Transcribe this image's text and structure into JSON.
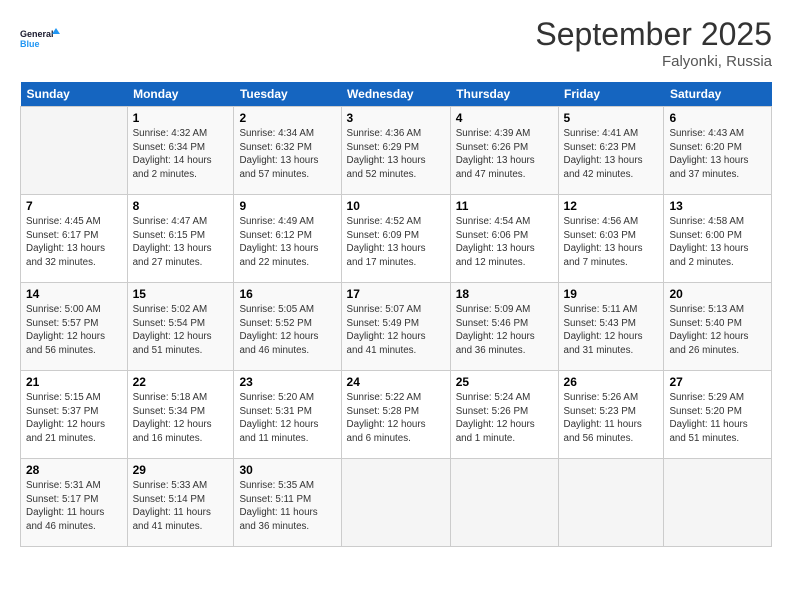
{
  "logo": {
    "line1": "General",
    "line2": "Blue"
  },
  "title": "September 2025",
  "subtitle": "Falyonki, Russia",
  "weekdays": [
    "Sunday",
    "Monday",
    "Tuesday",
    "Wednesday",
    "Thursday",
    "Friday",
    "Saturday"
  ],
  "weeks": [
    [
      {
        "day": "",
        "info": ""
      },
      {
        "day": "1",
        "info": "Sunrise: 4:32 AM\nSunset: 6:34 PM\nDaylight: 14 hours\nand 2 minutes."
      },
      {
        "day": "2",
        "info": "Sunrise: 4:34 AM\nSunset: 6:32 PM\nDaylight: 13 hours\nand 57 minutes."
      },
      {
        "day": "3",
        "info": "Sunrise: 4:36 AM\nSunset: 6:29 PM\nDaylight: 13 hours\nand 52 minutes."
      },
      {
        "day": "4",
        "info": "Sunrise: 4:39 AM\nSunset: 6:26 PM\nDaylight: 13 hours\nand 47 minutes."
      },
      {
        "day": "5",
        "info": "Sunrise: 4:41 AM\nSunset: 6:23 PM\nDaylight: 13 hours\nand 42 minutes."
      },
      {
        "day": "6",
        "info": "Sunrise: 4:43 AM\nSunset: 6:20 PM\nDaylight: 13 hours\nand 37 minutes."
      }
    ],
    [
      {
        "day": "7",
        "info": "Sunrise: 4:45 AM\nSunset: 6:17 PM\nDaylight: 13 hours\nand 32 minutes."
      },
      {
        "day": "8",
        "info": "Sunrise: 4:47 AM\nSunset: 6:15 PM\nDaylight: 13 hours\nand 27 minutes."
      },
      {
        "day": "9",
        "info": "Sunrise: 4:49 AM\nSunset: 6:12 PM\nDaylight: 13 hours\nand 22 minutes."
      },
      {
        "day": "10",
        "info": "Sunrise: 4:52 AM\nSunset: 6:09 PM\nDaylight: 13 hours\nand 17 minutes."
      },
      {
        "day": "11",
        "info": "Sunrise: 4:54 AM\nSunset: 6:06 PM\nDaylight: 13 hours\nand 12 minutes."
      },
      {
        "day": "12",
        "info": "Sunrise: 4:56 AM\nSunset: 6:03 PM\nDaylight: 13 hours\nand 7 minutes."
      },
      {
        "day": "13",
        "info": "Sunrise: 4:58 AM\nSunset: 6:00 PM\nDaylight: 13 hours\nand 2 minutes."
      }
    ],
    [
      {
        "day": "14",
        "info": "Sunrise: 5:00 AM\nSunset: 5:57 PM\nDaylight: 12 hours\nand 56 minutes."
      },
      {
        "day": "15",
        "info": "Sunrise: 5:02 AM\nSunset: 5:54 PM\nDaylight: 12 hours\nand 51 minutes."
      },
      {
        "day": "16",
        "info": "Sunrise: 5:05 AM\nSunset: 5:52 PM\nDaylight: 12 hours\nand 46 minutes."
      },
      {
        "day": "17",
        "info": "Sunrise: 5:07 AM\nSunset: 5:49 PM\nDaylight: 12 hours\nand 41 minutes."
      },
      {
        "day": "18",
        "info": "Sunrise: 5:09 AM\nSunset: 5:46 PM\nDaylight: 12 hours\nand 36 minutes."
      },
      {
        "day": "19",
        "info": "Sunrise: 5:11 AM\nSunset: 5:43 PM\nDaylight: 12 hours\nand 31 minutes."
      },
      {
        "day": "20",
        "info": "Sunrise: 5:13 AM\nSunset: 5:40 PM\nDaylight: 12 hours\nand 26 minutes."
      }
    ],
    [
      {
        "day": "21",
        "info": "Sunrise: 5:15 AM\nSunset: 5:37 PM\nDaylight: 12 hours\nand 21 minutes."
      },
      {
        "day": "22",
        "info": "Sunrise: 5:18 AM\nSunset: 5:34 PM\nDaylight: 12 hours\nand 16 minutes."
      },
      {
        "day": "23",
        "info": "Sunrise: 5:20 AM\nSunset: 5:31 PM\nDaylight: 12 hours\nand 11 minutes."
      },
      {
        "day": "24",
        "info": "Sunrise: 5:22 AM\nSunset: 5:28 PM\nDaylight: 12 hours\nand 6 minutes."
      },
      {
        "day": "25",
        "info": "Sunrise: 5:24 AM\nSunset: 5:26 PM\nDaylight: 12 hours\nand 1 minute."
      },
      {
        "day": "26",
        "info": "Sunrise: 5:26 AM\nSunset: 5:23 PM\nDaylight: 11 hours\nand 56 minutes."
      },
      {
        "day": "27",
        "info": "Sunrise: 5:29 AM\nSunset: 5:20 PM\nDaylight: 11 hours\nand 51 minutes."
      }
    ],
    [
      {
        "day": "28",
        "info": "Sunrise: 5:31 AM\nSunset: 5:17 PM\nDaylight: 11 hours\nand 46 minutes."
      },
      {
        "day": "29",
        "info": "Sunrise: 5:33 AM\nSunset: 5:14 PM\nDaylight: 11 hours\nand 41 minutes."
      },
      {
        "day": "30",
        "info": "Sunrise: 5:35 AM\nSunset: 5:11 PM\nDaylight: 11 hours\nand 36 minutes."
      },
      {
        "day": "",
        "info": ""
      },
      {
        "day": "",
        "info": ""
      },
      {
        "day": "",
        "info": ""
      },
      {
        "day": "",
        "info": ""
      }
    ]
  ]
}
